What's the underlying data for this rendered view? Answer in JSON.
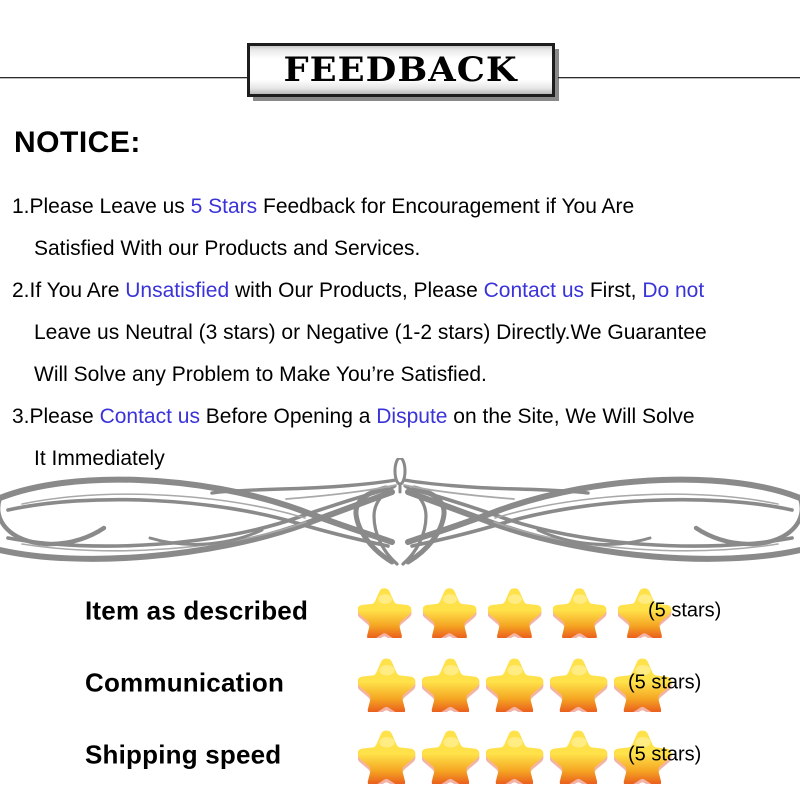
{
  "banner": {
    "title": "FEEDBACK"
  },
  "notice": {
    "heading": "NOTICE:",
    "lines": [
      {
        "segments": [
          {
            "text": "1.Please Leave us  ",
            "style": "plain"
          },
          {
            "text": "5 Stars",
            "style": "highlight"
          },
          {
            "text": "  Feedback for  Encouragement  if You Are",
            "style": "plain"
          }
        ],
        "indent": false
      },
      {
        "segments": [
          {
            "text": "Satisfied With our Products and Services.",
            "style": "plain"
          }
        ],
        "indent": true
      },
      {
        "segments": [
          {
            "text": "2.If You Are ",
            "style": "plain"
          },
          {
            "text": "Unsatisfied",
            "style": "highlight"
          },
          {
            "text": " with Our Products, Please ",
            "style": "plain"
          },
          {
            "text": "Contact us",
            "style": "highlight"
          },
          {
            "text": " First, ",
            "style": "plain"
          },
          {
            "text": "Do not",
            "style": "highlight"
          }
        ],
        "indent": false
      },
      {
        "segments": [
          {
            "text": "Leave us Neutral (3 stars) or Negative (1-2 stars) Directly.We Guarantee",
            "style": "plain"
          }
        ],
        "indent": true
      },
      {
        "segments": [
          {
            "text": "Will Solve any Problem to Make You’re  Satisfied.",
            "style": "plain"
          }
        ],
        "indent": true
      },
      {
        "segments": [
          {
            "text": "3.Please ",
            "style": "plain"
          },
          {
            "text": "Contact us",
            "style": "highlight"
          },
          {
            "text": " Before Opening a ",
            "style": "plain"
          },
          {
            "text": "Dispute",
            "style": "highlight"
          },
          {
            "text": " on the Site, We Will Solve",
            "style": "plain"
          }
        ],
        "indent": false
      },
      {
        "segments": [
          {
            "text": "It Immediately",
            "style": "plain"
          }
        ],
        "indent": true
      }
    ]
  },
  "ornament": {
    "name": "flourish-divider",
    "color": "#8a8a8a"
  },
  "ratings": {
    "rows": [
      {
        "label": "Item as described",
        "stars": 5,
        "count_label": "(5 stars)",
        "spacing": "wide"
      },
      {
        "label": "Communication",
        "stars": 5,
        "count_label": "(5 stars)",
        "spacing": "tight"
      },
      {
        "label": "Shipping speed",
        "stars": 5,
        "count_label": "(5 stars)",
        "spacing": "tight"
      }
    ],
    "star_colors": {
      "top": "#ffe14a",
      "mid": "#f5a623",
      "bottom": "#e8531c",
      "shadow": "#f09a8a"
    }
  }
}
